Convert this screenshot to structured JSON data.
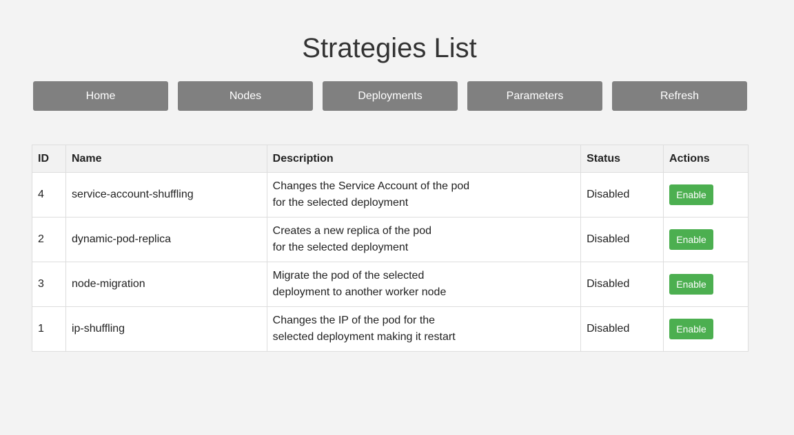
{
  "page": {
    "title": "Strategies List"
  },
  "nav": {
    "home_label": "Home",
    "nodes_label": "Nodes",
    "deployments_label": "Deployments",
    "parameters_label": "Parameters",
    "refresh_label": "Refresh"
  },
  "table": {
    "headers": {
      "id": "ID",
      "name": "Name",
      "description": "Description",
      "status": "Status",
      "actions": "Actions"
    },
    "rows": [
      {
        "id": "4",
        "name": "service-account-shuffling",
        "description_line1": "Changes the Service Account of the pod",
        "description_line2": "for the selected deployment",
        "status": "Disabled",
        "action_label": "Enable"
      },
      {
        "id": "2",
        "name": "dynamic-pod-replica",
        "description_line1": "Creates a new replica of the pod",
        "description_line2": "for the selected deployment",
        "status": "Disabled",
        "action_label": "Enable"
      },
      {
        "id": "3",
        "name": "node-migration",
        "description_line1": "Migrate the pod of the selected",
        "description_line2": "deployment to another worker node",
        "status": "Disabled",
        "action_label": "Enable"
      },
      {
        "id": "1",
        "name": "ip-shuffling",
        "description_line1": "Changes the IP of the pod for the",
        "description_line2": "selected deployment making it restart",
        "status": "Disabled",
        "action_label": "Enable"
      }
    ]
  },
  "colors": {
    "background": "#f3f3f3",
    "nav_button": "#808080",
    "enable_button": "#4caf50",
    "table_header": "#f2f2f2",
    "border": "#dddddd"
  }
}
